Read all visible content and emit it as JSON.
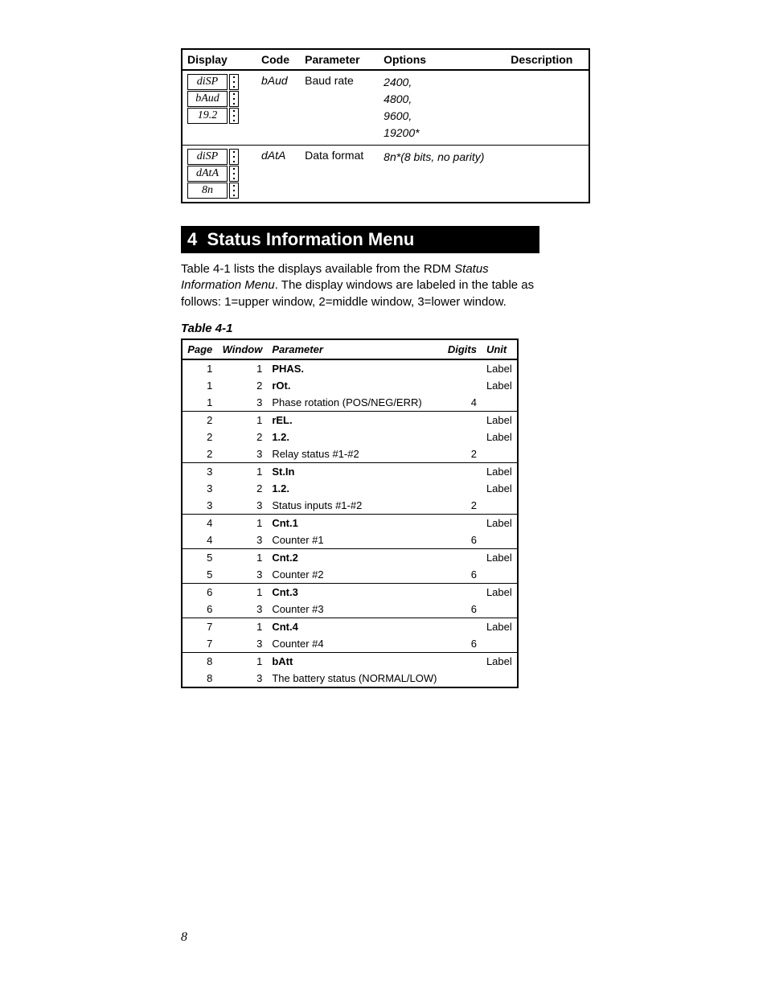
{
  "top_table": {
    "headers": [
      "Display",
      "Code",
      "Parameter",
      "Options",
      "Description"
    ],
    "rows": [
      {
        "display": [
          "diSP",
          "bAud",
          "19.2"
        ],
        "code": "bAud",
        "parameter": "Baud rate",
        "options": [
          "2400,",
          "4800,",
          "9600,",
          "19200*"
        ],
        "description": ""
      },
      {
        "display": [
          "diSP",
          "dAtA",
          "8n"
        ],
        "code": "dAtA",
        "parameter": "Data format",
        "options": [
          "8n*(8 bits, no parity)"
        ],
        "description": ""
      }
    ]
  },
  "section": {
    "number": "4",
    "title": "Status Information Menu"
  },
  "intro": {
    "line1_a": "Table 4-1 lists the displays available from the RDM ",
    "line1_em": "Status Information Menu",
    "line1_b": ". The display windows are labeled in the table as follows: 1=upper window, 2=middle window, 3=lower window."
  },
  "table41": {
    "caption": "Table 4-1",
    "headers": [
      "Page",
      "Window",
      "Parameter",
      "Digits",
      "Unit"
    ],
    "groups": [
      [
        {
          "page": "1",
          "window": "1",
          "parameter": "PHAS.",
          "bold": true,
          "digits": "",
          "unit": "Label"
        },
        {
          "page": "1",
          "window": "2",
          "parameter": "rOt.",
          "bold": true,
          "digits": "",
          "unit": "Label"
        },
        {
          "page": "1",
          "window": "3",
          "parameter": "Phase rotation (POS/NEG/ERR)",
          "bold": false,
          "digits": "4",
          "unit": ""
        }
      ],
      [
        {
          "page": "2",
          "window": "1",
          "parameter": "rEL.",
          "bold": true,
          "digits": "",
          "unit": "Label"
        },
        {
          "page": "2",
          "window": "2",
          "parameter": "1.2.",
          "bold": true,
          "digits": "",
          "unit": "Label"
        },
        {
          "page": "2",
          "window": "3",
          "parameter": "Relay status #1-#2",
          "bold": false,
          "digits": "2",
          "unit": ""
        }
      ],
      [
        {
          "page": "3",
          "window": "1",
          "parameter": "St.In",
          "bold": true,
          "digits": "",
          "unit": "Label"
        },
        {
          "page": "3",
          "window": "2",
          "parameter": "1.2.",
          "bold": true,
          "digits": "",
          "unit": "Label"
        },
        {
          "page": "3",
          "window": "3",
          "parameter": "Status inputs #1-#2",
          "bold": false,
          "digits": "2",
          "unit": ""
        }
      ],
      [
        {
          "page": "4",
          "window": "1",
          "parameter": "Cnt.1",
          "bold": true,
          "digits": "",
          "unit": "Label"
        },
        {
          "page": "4",
          "window": "3",
          "parameter": "Counter #1",
          "bold": false,
          "digits": "6",
          "unit": ""
        }
      ],
      [
        {
          "page": "5",
          "window": "1",
          "parameter": "Cnt.2",
          "bold": true,
          "digits": "",
          "unit": "Label"
        },
        {
          "page": "5",
          "window": "3",
          "parameter": "Counter #2",
          "bold": false,
          "digits": "6",
          "unit": ""
        }
      ],
      [
        {
          "page": "6",
          "window": "1",
          "parameter": "Cnt.3",
          "bold": true,
          "digits": "",
          "unit": "Label"
        },
        {
          "page": "6",
          "window": "3",
          "parameter": "Counter #3",
          "bold": false,
          "digits": "6",
          "unit": ""
        }
      ],
      [
        {
          "page": "7",
          "window": "1",
          "parameter": "Cnt.4",
          "bold": true,
          "digits": "",
          "unit": "Label"
        },
        {
          "page": "7",
          "window": "3",
          "parameter": "Counter #4",
          "bold": false,
          "digits": "6",
          "unit": ""
        }
      ],
      [
        {
          "page": "8",
          "window": "1",
          "parameter": "bAtt",
          "bold": true,
          "digits": "",
          "unit": "Label"
        },
        {
          "page": "8",
          "window": "3",
          "parameter": "The battery status (NORMAL/LOW)",
          "bold": false,
          "digits": "",
          "unit": ""
        }
      ]
    ]
  },
  "page_number": "8"
}
